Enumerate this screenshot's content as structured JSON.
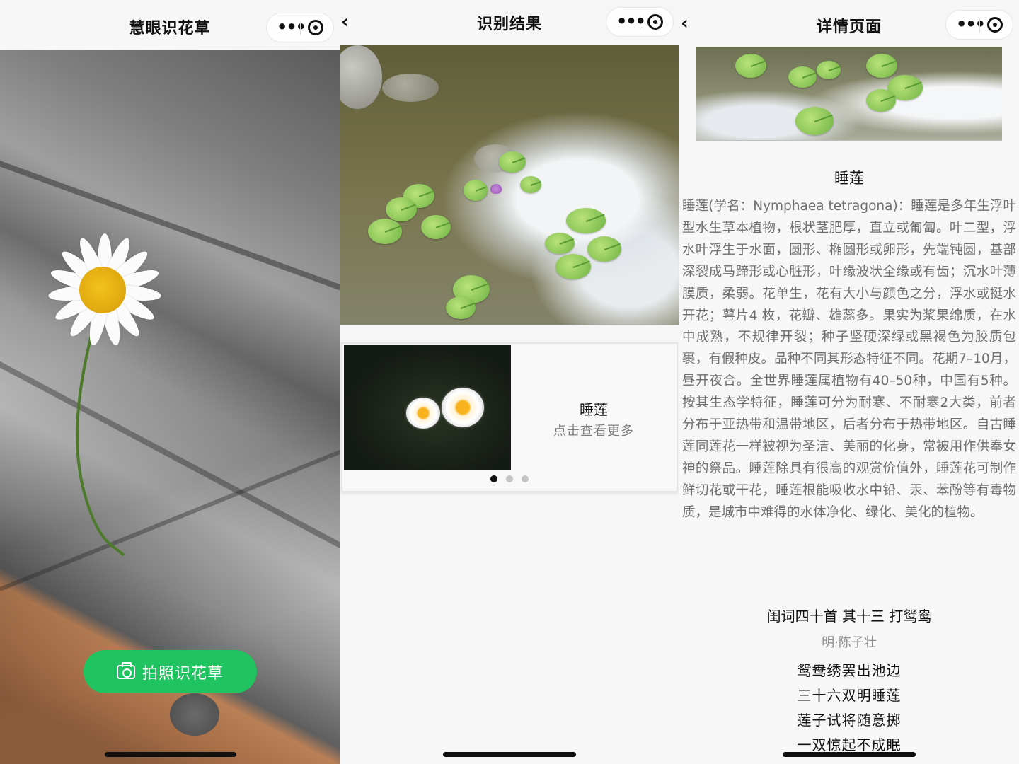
{
  "screen1": {
    "title": "慧眼识花草",
    "scan_button_label": "拍照识花草"
  },
  "screen2": {
    "title": "识别结果",
    "result_card": {
      "name": "睡莲",
      "subtitle": "点击查看更多",
      "carousel_pages": 3,
      "carousel_active_index": 0
    }
  },
  "screen3": {
    "title": "详情页面",
    "name": "睡莲",
    "description": "睡莲(学名：Nymphaea tetragona)：睡莲是多年生浮叶型水生草本植物，根状茎肥厚，直立或匍匐。叶二型，浮水叶浮生于水面，圆形、椭圆形或卵形，先端钝圆，基部深裂成马蹄形或心脏形，叶缘波状全缘或有齿；沉水叶薄膜质，柔弱。花单生，花有大小与颜色之分，浮水或挺水开花；萼片4 枚，花瓣、雄蕊多。果实为浆果绵质，在水中成熟，不规律开裂；种子坚硬深绿或黑褐色为胶质包裹，有假种皮。品种不同其形态特征不同。花期7–10月，昼开夜合。全世界睡莲属植物有40–50种，中国有5种。按其生态学特征，睡莲可分为耐寒、不耐寒2大类，前者分布于亚热带和温带地区，后者分布于热带地区。自古睡莲同莲花一样被视为圣洁、美丽的化身，常被用作供奉女神的祭品。睡莲除具有很高的观赏价值外，睡莲花可制作鲜切花或干花，睡莲根能吸收水中铅、汞、苯酚等有毒物质，是城市中难得的水体净化、绿化、美化的植物。",
    "poem": {
      "title": "闺词四十首 其十三 打鸳鸯",
      "author": "明·陈子壮",
      "lines": [
        "鸳鸯绣罢出池边",
        "三十六双明睡莲",
        "莲子试将随意掷",
        "一双惊起不成眠"
      ]
    }
  },
  "icons": {
    "more": "more-dots-icon",
    "close": "target-close-icon",
    "back": "chevron-left-icon",
    "camera": "camera-icon"
  },
  "colors": {
    "accent_green": "#1fc35f",
    "text_dark": "#111111",
    "text_gray": "#6f6f6f",
    "dot_active": "#111111",
    "dot_inactive": "#c4c4c4"
  }
}
